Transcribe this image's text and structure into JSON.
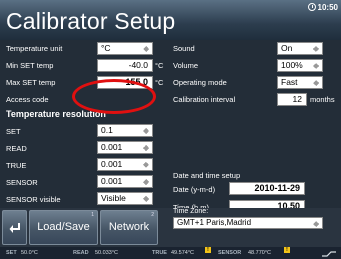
{
  "header": {
    "title": "Calibrator Setup",
    "time": "10:50"
  },
  "left": {
    "temperature_unit": {
      "label": "Temperature unit",
      "value": "°C"
    },
    "min_set_temp": {
      "label": "Min SET temp",
      "value": "-40.0",
      "unit": "°C"
    },
    "max_set_temp": {
      "label": "Max SET temp",
      "value": "155.0",
      "unit": "°C"
    },
    "access_code": {
      "label": "Access code"
    },
    "resolution_header": "Temperature resolution",
    "set": {
      "label": "SET",
      "value": "0.1"
    },
    "read": {
      "label": "READ",
      "value": "0.001"
    },
    "true": {
      "label": "TRUE",
      "value": "0.001"
    },
    "sensor": {
      "label": "SENSOR",
      "value": "0.001"
    },
    "sensor_visible": {
      "label": "SENSOR visible",
      "value": "Visible"
    }
  },
  "right": {
    "sound": {
      "label": "Sound",
      "value": "On"
    },
    "volume": {
      "label": "Volume",
      "value": "100%"
    },
    "operating_mode": {
      "label": "Operating mode",
      "value": "Fast"
    },
    "calibration_interval": {
      "label": "Calibration  interval",
      "value": "12",
      "unit": "months"
    },
    "datetime_header": "Date and time setup",
    "date": {
      "label": "Date (y-m-d)",
      "value": "2010-11-29"
    },
    "time": {
      "label": "Time (h.m)",
      "value": "10.50"
    },
    "timezone": {
      "label": "Time Zone:",
      "value": "GMT+1 Paris,Madrid"
    }
  },
  "buttons": {
    "back_icon": "return-arrow-icon",
    "load_save": {
      "label": "Load/Save",
      "num": "1"
    },
    "network": {
      "label": "Network",
      "num": "2"
    }
  },
  "status": {
    "set_label": "SET",
    "set_value": "50.0°C",
    "read_label": "READ",
    "read_value": "50.033°C",
    "true_label": "TRUE",
    "true_value": "49.574°C",
    "true_badge": "!",
    "sensor_label": "SENSOR",
    "sensor_value": "48.770°C",
    "sensor_badge": "!"
  },
  "colors": {
    "highlight": "#e01010",
    "warning": "#f2c318"
  }
}
